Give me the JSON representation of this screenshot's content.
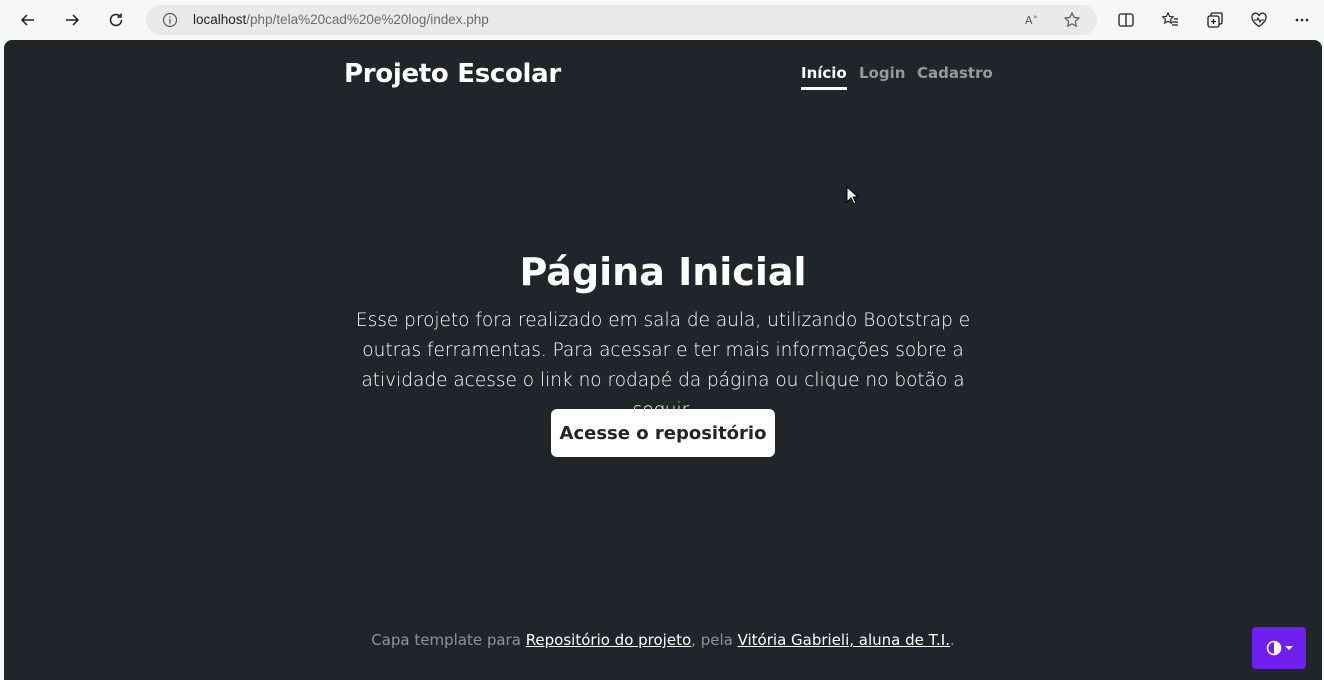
{
  "browser": {
    "url_host": "localhost",
    "url_path": "/php/tela%20cad%20e%20log/index.php"
  },
  "navbar": {
    "brand": "Projeto Escolar",
    "links": [
      {
        "label": "Início",
        "active": true
      },
      {
        "label": "Login",
        "active": false
      },
      {
        "label": "Cadastro",
        "active": false
      }
    ]
  },
  "hero": {
    "title": "Página Inicial",
    "lead": "Esse projeto fora realizado em sala de aula, utilizando Bootstrap e outras ferramentas. Para acessar e ter mais informações sobre a atividade acesse o link no rodapé da página ou clique no botão a seguir.",
    "button_label": "Acesse o repositório"
  },
  "footer": {
    "prefix": "Capa template para ",
    "repo_link": "Repositório do projeto",
    "middle": ", pela ",
    "author_link": "Vitória Gabrieli, aluna de T.I.",
    "suffix": "."
  },
  "colors": {
    "background": "#212529",
    "toggle_accent": "#6f1ff0"
  },
  "icons": {
    "theme_toggle": "half-circle-contrast-icon"
  }
}
